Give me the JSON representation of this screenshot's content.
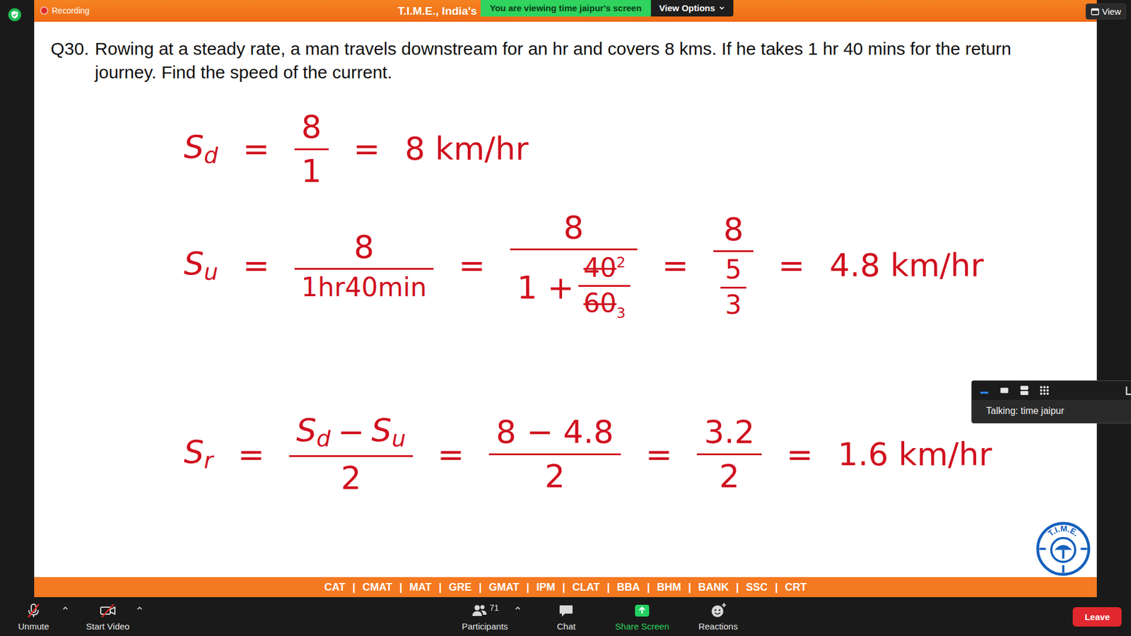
{
  "top_bar": {
    "recording": "Recording",
    "title": "T.I.M.E., India's",
    "banner": "You are viewing time jaipur's screen",
    "view_options": "View Options",
    "view": "View"
  },
  "slide": {
    "question_number": "Q30.",
    "question": "Rowing at a steady rate, a man travels downstream for an hr and covers 8 kms. If he takes 1 hr 40 mins for the return journey. Find the speed of the current.",
    "working": [
      [
        {
          "kind": "var",
          "base": "S",
          "sub": "d"
        },
        {
          "kind": "op",
          "text": "="
        },
        {
          "kind": "frac",
          "num": "8",
          "den": "1"
        },
        {
          "kind": "op",
          "text": "="
        },
        {
          "kind": "text",
          "text": "8 km/hr"
        }
      ],
      [
        {
          "kind": "var",
          "base": "S",
          "sub": "u"
        },
        {
          "kind": "op",
          "text": "="
        },
        {
          "kind": "frac",
          "num": "8",
          "den": "1hr40min"
        },
        {
          "kind": "op",
          "text": "="
        },
        {
          "kind": "cfrac",
          "num": "8",
          "lead": "1 +",
          "inner_num": "40",
          "inner_den": "60",
          "num_note": "2",
          "den_note": "3",
          "struck": true
        },
        {
          "kind": "op",
          "text": "="
        },
        {
          "kind": "ffrac",
          "num": "8",
          "inner_num": "5",
          "inner_den": "3"
        },
        {
          "kind": "op",
          "text": "="
        },
        {
          "kind": "text",
          "text": "4.8 km/hr"
        }
      ],
      [
        {
          "kind": "var",
          "base": "S",
          "sub": "r"
        },
        {
          "kind": "op",
          "text": "="
        },
        {
          "kind": "vfrac",
          "left": {
            "base": "S",
            "sub": "d"
          },
          "op": "−",
          "right": {
            "base": "S",
            "sub": "u"
          },
          "den": "2"
        },
        {
          "kind": "op",
          "text": "="
        },
        {
          "kind": "frac",
          "num": "8 − 4.8",
          "den": "2"
        },
        {
          "kind": "op",
          "text": "="
        },
        {
          "kind": "frac",
          "num": "3.2",
          "den": "2"
        },
        {
          "kind": "op",
          "text": "="
        },
        {
          "kind": "text",
          "text": "1.6 km/hr"
        }
      ]
    ],
    "logo": "T.I.M.E."
  },
  "exam_bar": {
    "separator": "|",
    "items": [
      "CAT",
      "CMAT",
      "MAT",
      "GRE",
      "GMAT",
      "IPM",
      "CLAT",
      "BBA",
      "BHM",
      "BANK",
      "SSC",
      "CRT"
    ]
  },
  "talking_panel": {
    "text": "Talking: time jaipur"
  },
  "toolbar": {
    "left": [
      {
        "label": "Unmute",
        "kind": "mic",
        "off": true,
        "menu": true
      },
      {
        "label": "Start Video",
        "kind": "video",
        "off": true,
        "menu": true
      }
    ],
    "center": [
      {
        "label": "Participants",
        "kind": "participants",
        "count": "71",
        "menu": true
      },
      {
        "label": "Chat",
        "kind": "chat",
        "count": "",
        "menu": false
      },
      {
        "label": "Share Screen",
        "kind": "share",
        "count": "",
        "menu": false
      },
      {
        "label": "Reactions",
        "kind": "reactions",
        "count": "",
        "menu": false
      }
    ],
    "leave": "Leave"
  }
}
